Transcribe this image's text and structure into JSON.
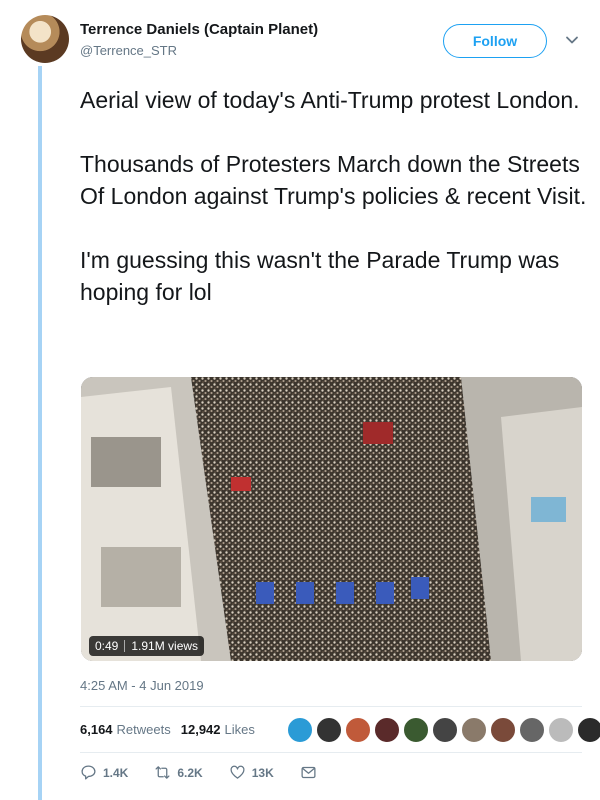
{
  "author": {
    "name": "Terrence Daniels (Captain Planet)",
    "handle": "@Terrence_STR"
  },
  "follow_label": "Follow",
  "tweet_text": "Aerial view of today's Anti-Trump protest London.\n\nThousands of Protesters March down the Streets Of London against Trump's policies & recent Visit.\n\nI'm guessing this wasn't the Parade Trump was hoping for lol",
  "media": {
    "duration": "0:49",
    "views": "1.91M views"
  },
  "timestamp": "4:25 AM - 4 Jun 2019",
  "stats": {
    "retweets_count": "6,164",
    "retweets_label": "Retweets",
    "likes_count": "12,942",
    "likes_label": "Likes"
  },
  "liker_avatars": [
    "#2a9bd6",
    "#333333",
    "#c05a3a",
    "#5a2a2a",
    "#3a5a30",
    "#444444",
    "#8a7a6a",
    "#7a4a3a",
    "#666666",
    "#bbbbbb",
    "#2a2a2a"
  ],
  "actions": {
    "reply": "1.4K",
    "retweet": "6.2K",
    "like": "13K"
  },
  "colors": {
    "accent": "#1da1f2",
    "thread_line": "#a6d3f5",
    "muted": "#657786"
  }
}
